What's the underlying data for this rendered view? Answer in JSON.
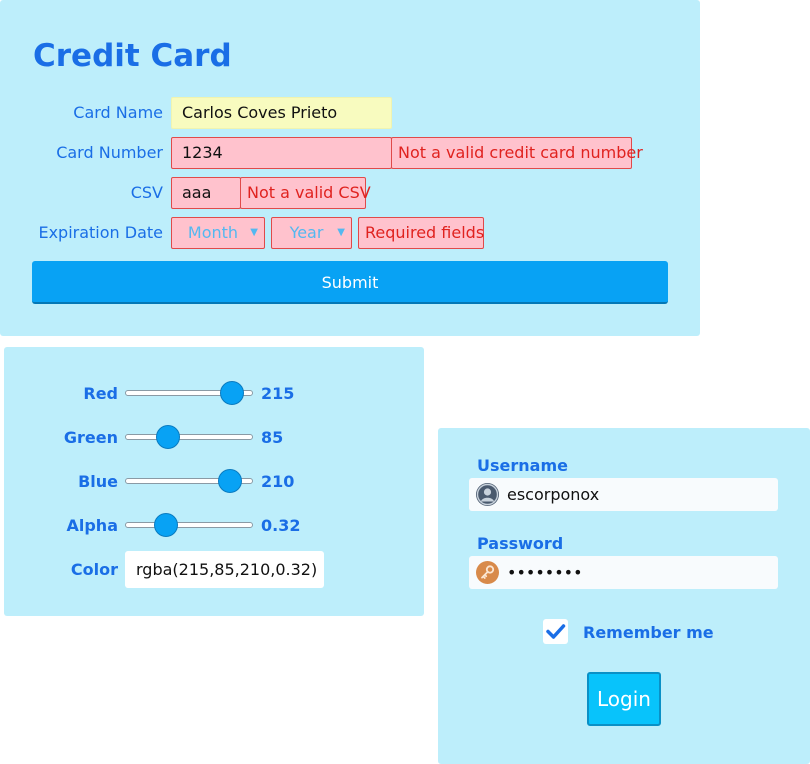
{
  "credit_card": {
    "title": "Credit Card",
    "card_name_label": "Card Name",
    "card_name_value": "Carlos Coves Prieto",
    "card_number_label": "Card Number",
    "card_number_value": "1234",
    "card_number_error": "Not a valid credit card number",
    "csv_label": "CSV",
    "csv_value": "aaa",
    "csv_error": "Not a valid CSV",
    "expiration_label": "Expiration Date",
    "month_placeholder": "Month",
    "year_placeholder": "Year",
    "expiration_error": "Required fields",
    "submit_label": "Submit"
  },
  "color_picker": {
    "sliders": [
      {
        "label": "Red",
        "value": "215",
        "fraction": 0.843
      },
      {
        "label": "Green",
        "value": "85",
        "fraction": 0.333
      },
      {
        "label": "Blue",
        "value": "210",
        "fraction": 0.824
      },
      {
        "label": "Alpha",
        "value": "0.32",
        "fraction": 0.32
      }
    ],
    "color_label": "Color",
    "color_value": "rgba(215,85,210,0.32)"
  },
  "login": {
    "username_label": "Username",
    "username_value": "escorponox",
    "password_label": "Password",
    "password_value": "••••••••",
    "remember_label": "Remember me",
    "remember_checked": true,
    "login_label": "Login"
  },
  "colors": {
    "panel_bg": "#bdeefb",
    "accent": "#1a6ee6",
    "button": "#08a2f4",
    "error": "#e0221f",
    "error_bg": "#ffc2cd",
    "valid_bg": "#f8fbbf"
  },
  "icons": {
    "user": "user-icon",
    "key": "key-icon",
    "check": "checkmark-icon",
    "chevron": "chevron-down-icon"
  }
}
